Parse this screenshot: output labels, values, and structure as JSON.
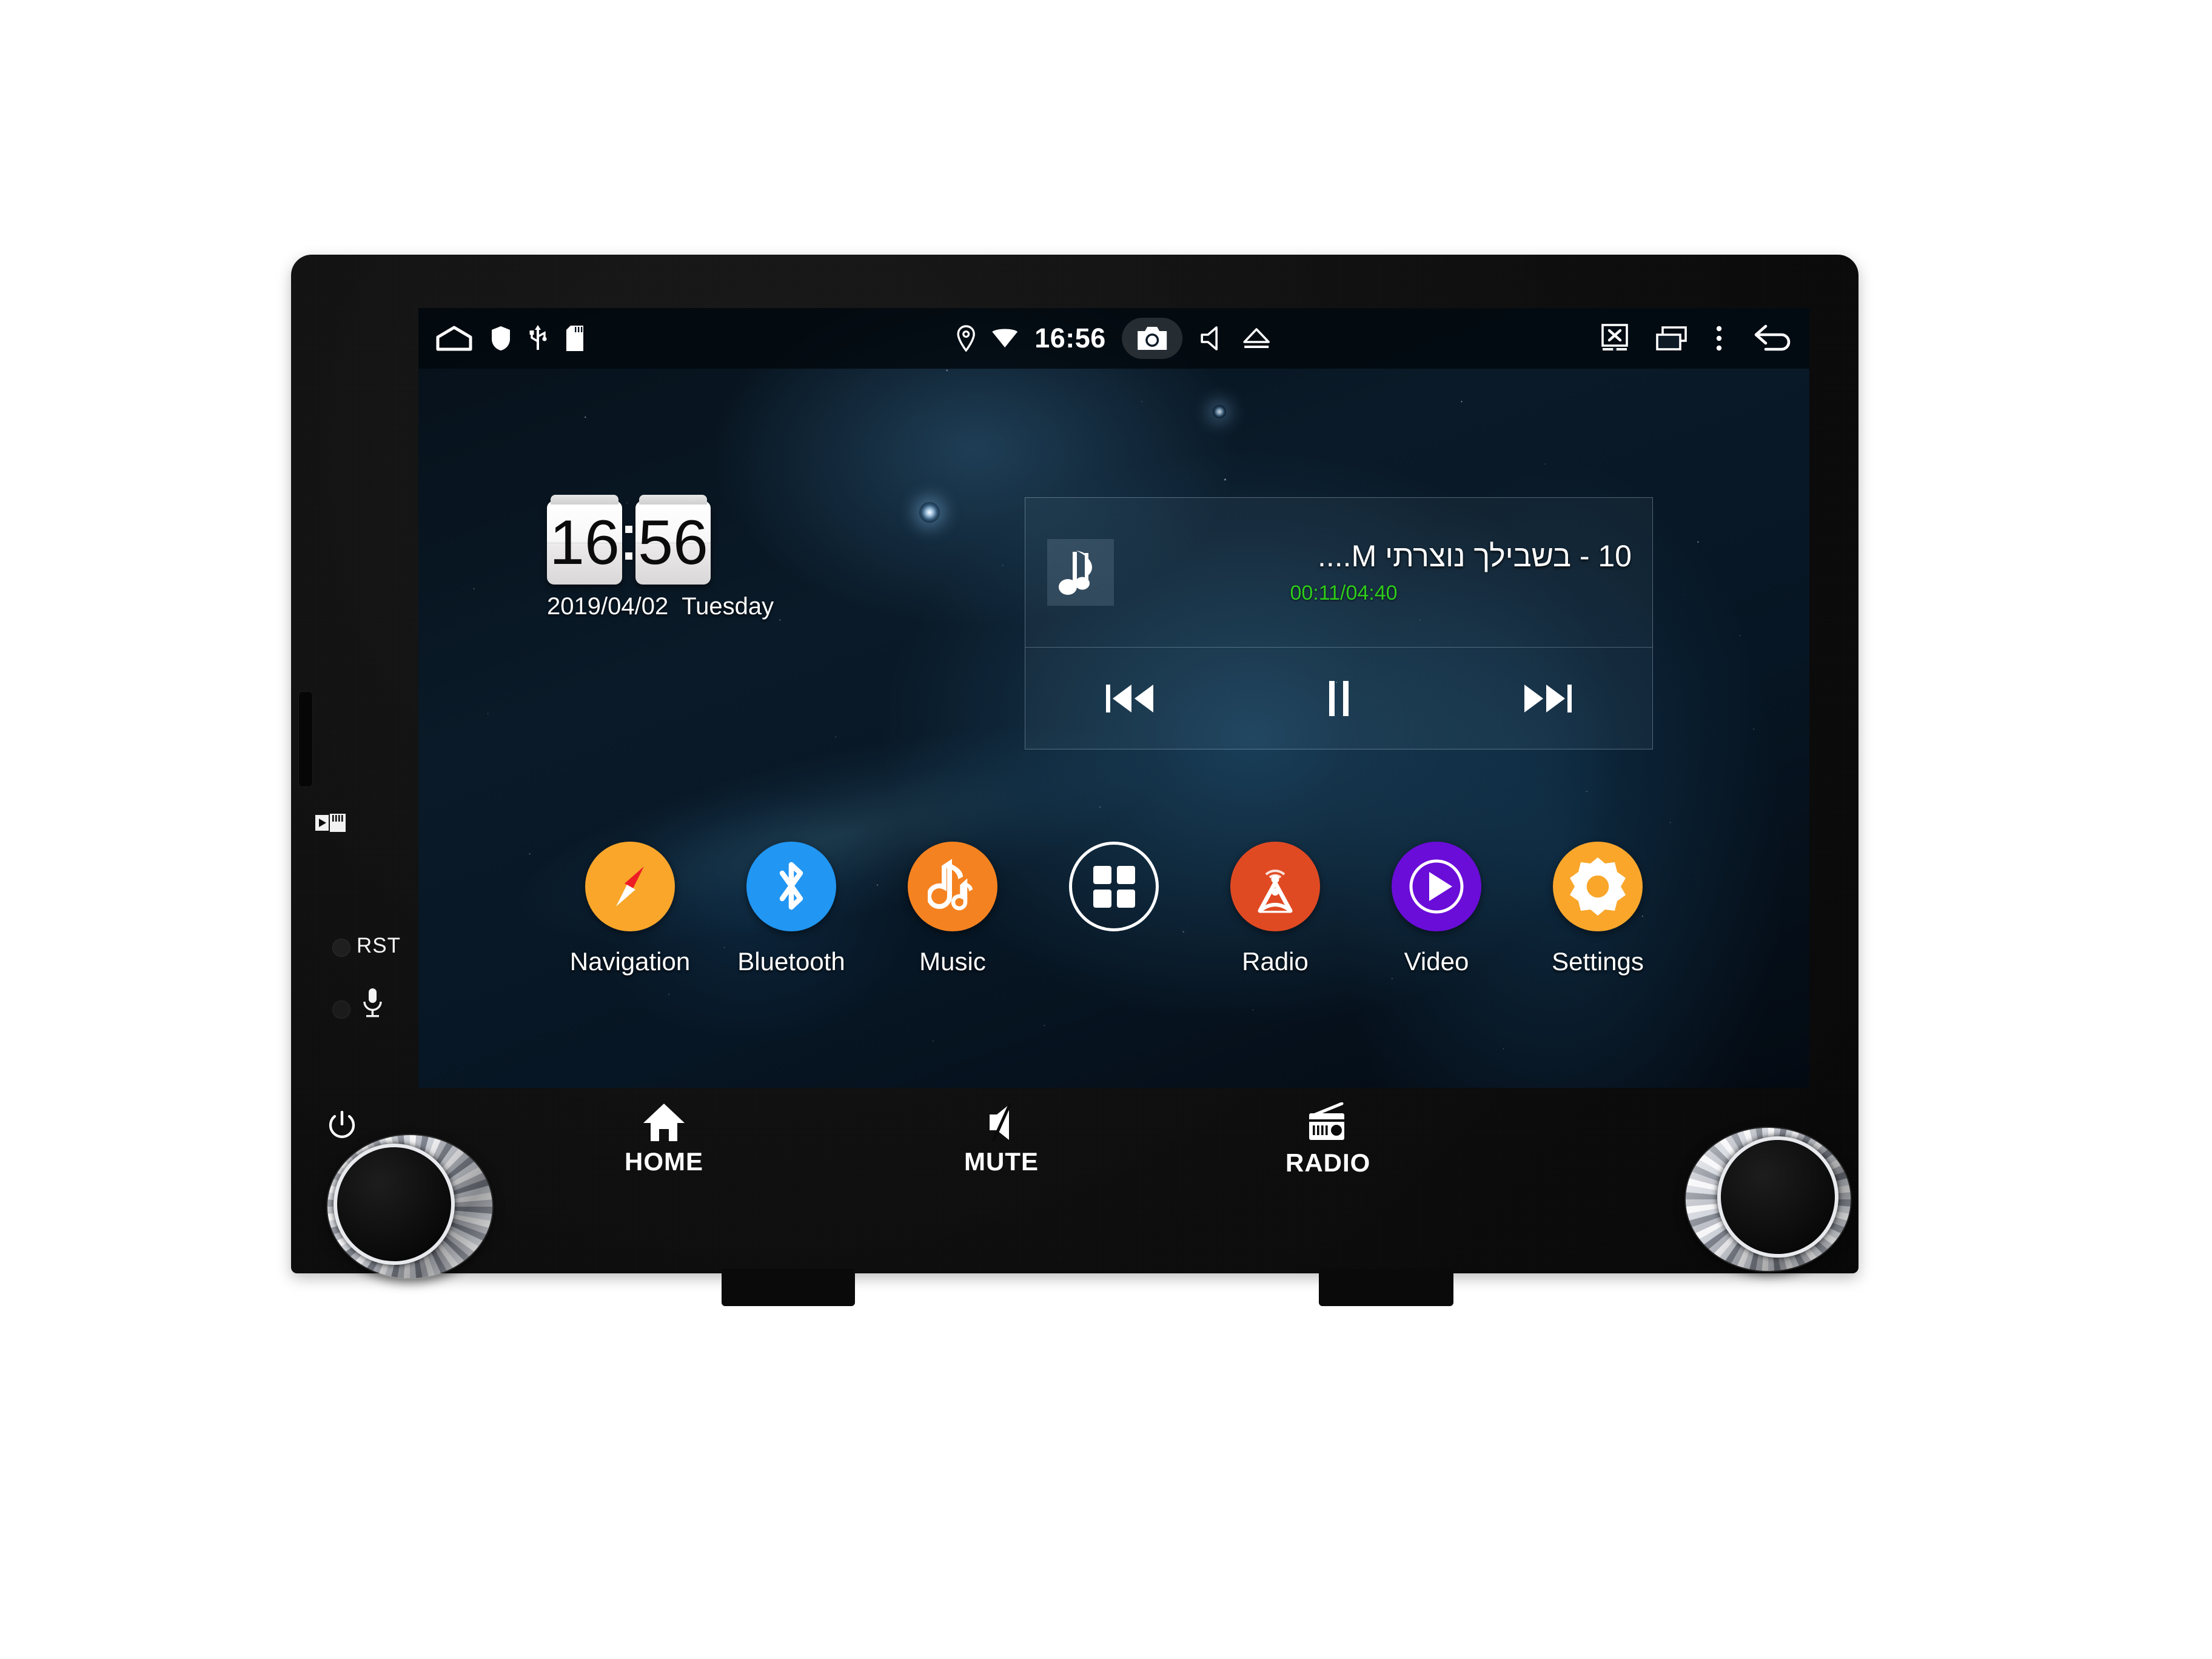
{
  "device": {
    "name": "android-car-head-unit",
    "bezel_controls": {
      "sd_slot_label": "",
      "reset_label": "RST",
      "mic_label": "",
      "power_label": ""
    }
  },
  "statusbar": {
    "left_icons": [
      {
        "name": "home-icon",
        "glyph": "home"
      },
      {
        "name": "shield-icon",
        "glyph": "shield"
      },
      {
        "name": "usb-icon",
        "glyph": "usb"
      },
      {
        "name": "sd-card-icon",
        "glyph": "sdcard"
      }
    ],
    "center": {
      "location_icon": "location-pin-icon",
      "wifi_icon": "wifi-icon",
      "time": "16:56",
      "camera_icon": "camera-icon",
      "volume_icon": "volume-icon",
      "eject_icon": "eject-icon"
    },
    "right_icons": [
      {
        "name": "screen-off-icon",
        "glyph": "screen-x"
      },
      {
        "name": "recent-apps-icon",
        "glyph": "recents"
      },
      {
        "name": "overflow-menu-icon",
        "glyph": "dots"
      },
      {
        "name": "back-icon",
        "glyph": "back-arrow"
      }
    ]
  },
  "clock_widget": {
    "hours": "16",
    "minutes": "56",
    "date": "2019/04/02",
    "weekday": "Tuesday"
  },
  "music_widget": {
    "album_art_icon": "music-note-icon",
    "track_title": "01 - בשבילך נוצרתי M....",
    "elapsed_total": "00:11/04:40",
    "controls": [
      {
        "name": "previous-track-button",
        "label": "previous"
      },
      {
        "name": "pause-button",
        "label": "pause"
      },
      {
        "name": "next-track-button",
        "label": "next"
      }
    ]
  },
  "dock": {
    "apps": [
      {
        "name": "navigation",
        "label": "Navigation",
        "icon": "compass-icon",
        "color": "#F9A62B"
      },
      {
        "name": "bluetooth",
        "label": "Bluetooth",
        "icon": "bluetooth-icon",
        "color": "#2196F3"
      },
      {
        "name": "music",
        "label": "Music",
        "icon": "music-note-icon",
        "color": "#F58220"
      },
      {
        "name": "app-drawer",
        "label": "",
        "icon": "grid-icon",
        "color": "transparent"
      },
      {
        "name": "radio",
        "label": "Radio",
        "icon": "radio-tower-icon",
        "color": "#E04A23"
      },
      {
        "name": "video",
        "label": "Video",
        "icon": "play-icon",
        "color": "#6A0DD8"
      },
      {
        "name": "settings",
        "label": "Settings",
        "icon": "gear-icon",
        "color": "#F9A62B"
      }
    ]
  },
  "hardware_buttons": [
    {
      "name": "home",
      "label": "HOME",
      "icon": "house-icon"
    },
    {
      "name": "mute",
      "label": "MUTE",
      "icon": "speaker-mute-icon"
    },
    {
      "name": "radio",
      "label": "RADIO",
      "icon": "radio-receiver-icon"
    }
  ],
  "colors": {
    "accent_amber": "#F9A62B",
    "accent_blue": "#2196F3",
    "accent_orange": "#F58220",
    "accent_red": "#E04A23",
    "accent_purple": "#6A0DD8",
    "time_green": "#2ECC1C",
    "screen_bg": "#061019"
  }
}
